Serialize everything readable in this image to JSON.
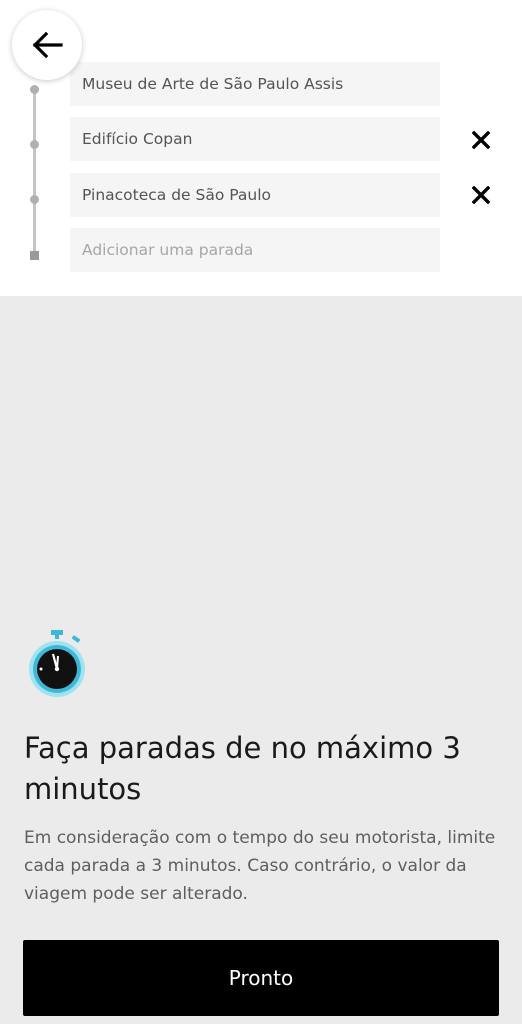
{
  "stops": [
    {
      "label": "Museu de Arte de São Paulo Assis",
      "removable": false
    },
    {
      "label": "Edifício Copan",
      "removable": true
    },
    {
      "label": "Pinacoteca de São Paulo",
      "removable": true
    }
  ],
  "add_stop": {
    "placeholder": "Adicionar uma parada"
  },
  "notice": {
    "icon": "stopwatch-icon",
    "title": "Faça paradas de no máximo 3 minutos",
    "body": "Em consideração com o tempo do seu motorista, limite cada parada a 3 minutos. Caso contrário, o valor da viagem pode ser alterado."
  },
  "done_button": {
    "label": "Pronto"
  },
  "colors": {
    "accent_timer": "#3fb8d8",
    "button_bg": "#000000",
    "sheet_bg": "#ebebeb"
  }
}
